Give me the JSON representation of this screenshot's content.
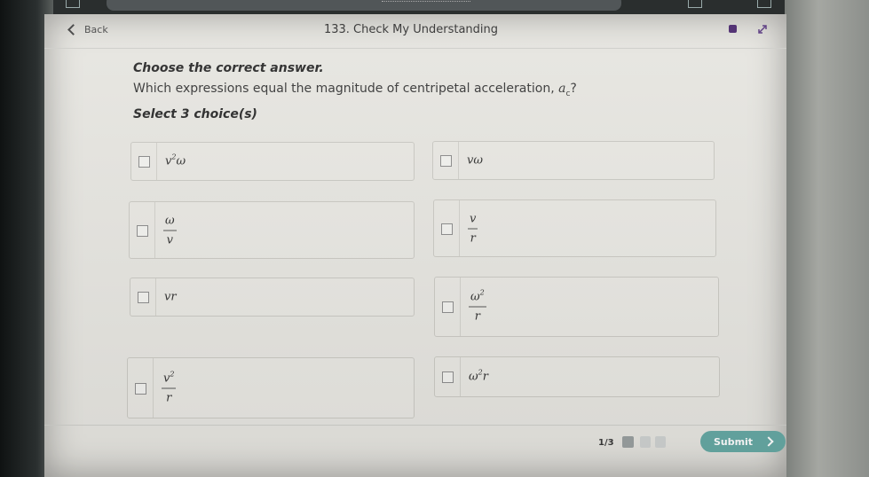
{
  "header": {
    "back_label": "Back",
    "title": "133. Check My Understanding"
  },
  "question": {
    "instruction": "Choose the correct answer.",
    "prompt_text": "Which expressions equal the magnitude of centripetal acceleration, ",
    "prompt_var": "a",
    "prompt_sub": "c",
    "prompt_end": "?",
    "select_text": "Select 3 choice(s)"
  },
  "choices": [
    {
      "base": "v",
      "sup": "2",
      "tail": "ω"
    },
    {
      "base": "vω"
    },
    {
      "num": "ω",
      "den": "v"
    },
    {
      "num": "v",
      "den": "r"
    },
    {
      "base": "vr"
    },
    {
      "num": "ω",
      "num_sup": "2",
      "den": "r"
    },
    {
      "num": "v",
      "num_sup": "2",
      "den": "r"
    },
    {
      "base": "ω",
      "sup": "2",
      "tail": "r"
    }
  ],
  "footer": {
    "progress": "1/3",
    "progress_current": 1,
    "progress_total": 3,
    "submit_label": "Submit"
  },
  "colors": {
    "accent": "#66a9a4",
    "progress_active": "#9aa0a0",
    "progress_inactive": "#cfd2d1"
  }
}
